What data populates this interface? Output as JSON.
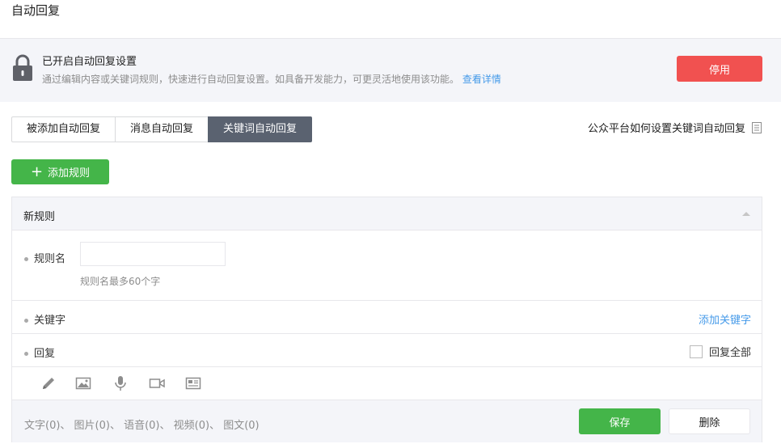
{
  "page": {
    "title": "自动回复"
  },
  "banner": {
    "title": "已开启自动回复设置",
    "description": "通过编辑内容或关键词规则，快速进行自动回复设置。如具备开发能力，可更灵活地使用该功能。",
    "link": "查看详情",
    "disable_button": "停用",
    "icon": "lock-icon"
  },
  "tabs": [
    {
      "label": "被添加自动回复",
      "active": false
    },
    {
      "label": "消息自动回复",
      "active": false
    },
    {
      "label": "关键词自动回复",
      "active": true
    }
  ],
  "help_link": {
    "label": "公众平台如何设置关键词自动回复",
    "icon": "document-icon"
  },
  "add_rule_button": "添加规则",
  "rule": {
    "header": "新规则",
    "name_label": "规则名",
    "name_value": "",
    "name_placeholder": "",
    "name_tip": "规则名最多60个字",
    "keyword_label": "关键字",
    "add_keyword": "添加关键字",
    "reply_label": "回复",
    "reply_all": "回复全部",
    "reply_all_checked": false,
    "tools": [
      "pencil-icon",
      "image-icon",
      "microphone-icon",
      "video-icon",
      "news-icon"
    ],
    "counts": "文字(0)、 图片(0)、 语音(0)、 视频(0)、 图文(0)",
    "save_button": "保存",
    "delete_button": "删除"
  },
  "colors": {
    "accent_green": "#44b549",
    "danger_red": "#f15150",
    "link_blue": "#459ae9",
    "tab_active": "#5a6270",
    "panel_bg": "#f4f5f9"
  }
}
